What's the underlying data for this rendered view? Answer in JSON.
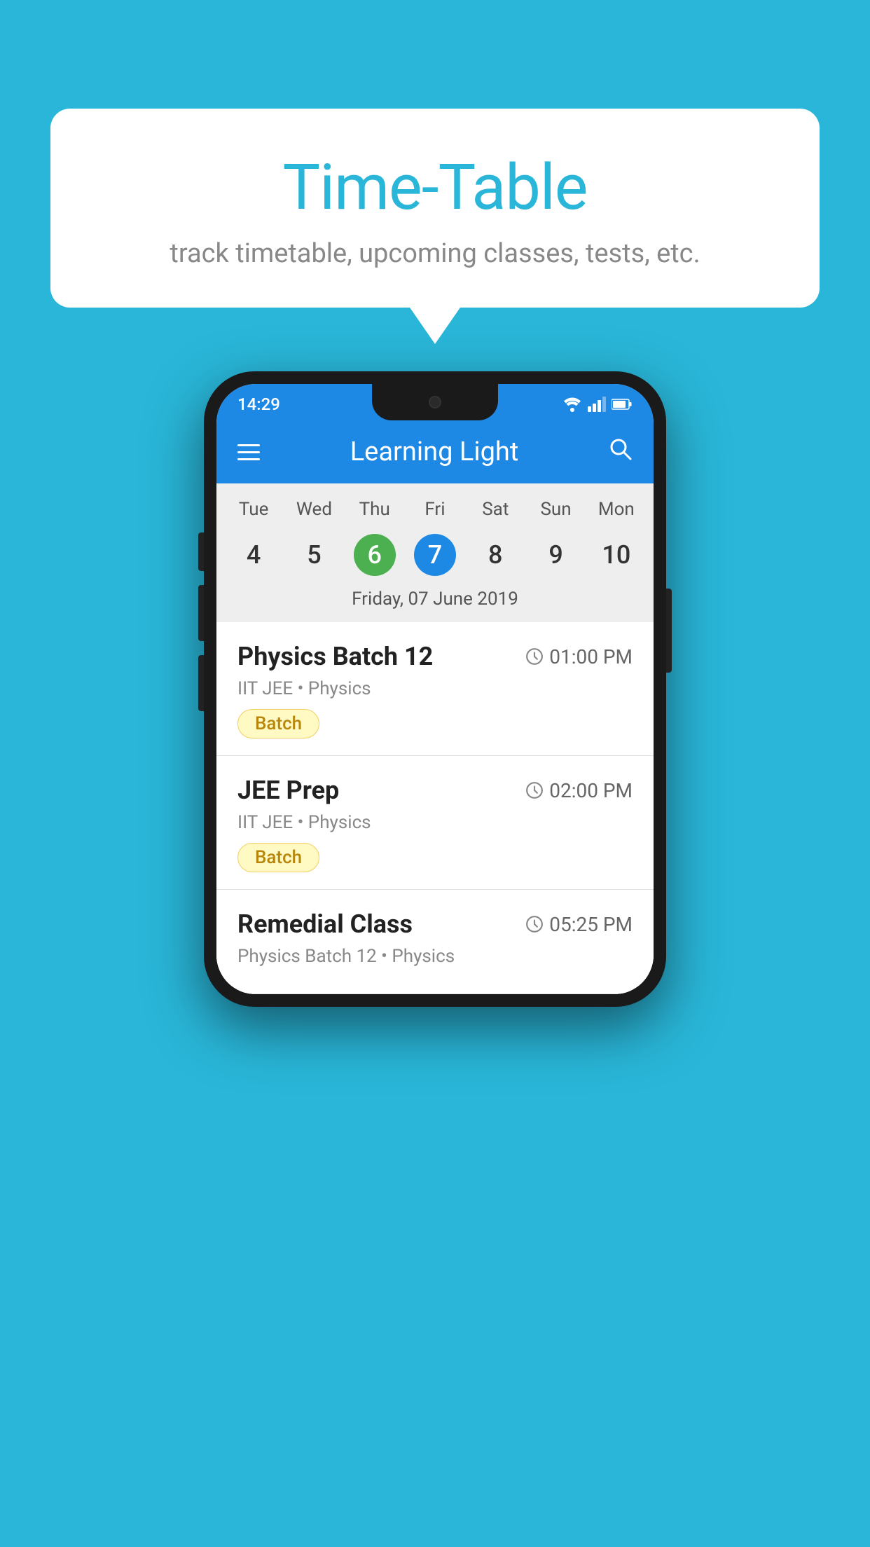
{
  "background_color": "#29b6d8",
  "speech_bubble": {
    "title": "Time-Table",
    "subtitle": "track timetable, upcoming classes, tests, etc."
  },
  "phone": {
    "status_bar": {
      "time": "14:29",
      "wifi": "wifi",
      "signal": "signal",
      "battery": "battery"
    },
    "toolbar": {
      "title": "Learning Light",
      "menu_icon": "hamburger-menu",
      "search_icon": "search"
    },
    "calendar": {
      "days": [
        "Tue",
        "Wed",
        "Thu",
        "Fri",
        "Sat",
        "Sun",
        "Mon"
      ],
      "dates": [
        {
          "num": "4",
          "state": "normal"
        },
        {
          "num": "5",
          "state": "normal"
        },
        {
          "num": "6",
          "state": "today"
        },
        {
          "num": "7",
          "state": "selected"
        },
        {
          "num": "8",
          "state": "normal"
        },
        {
          "num": "9",
          "state": "normal"
        },
        {
          "num": "10",
          "state": "normal"
        }
      ],
      "selected_date_label": "Friday, 07 June 2019"
    },
    "schedule": [
      {
        "title": "Physics Batch 12",
        "time": "01:00 PM",
        "subtitle": "IIT JEE • Physics",
        "badge": "Batch"
      },
      {
        "title": "JEE Prep",
        "time": "02:00 PM",
        "subtitle": "IIT JEE • Physics",
        "badge": "Batch"
      },
      {
        "title": "Remedial Class",
        "time": "05:25 PM",
        "subtitle": "Physics Batch 12 • Physics",
        "badge": null
      }
    ]
  }
}
